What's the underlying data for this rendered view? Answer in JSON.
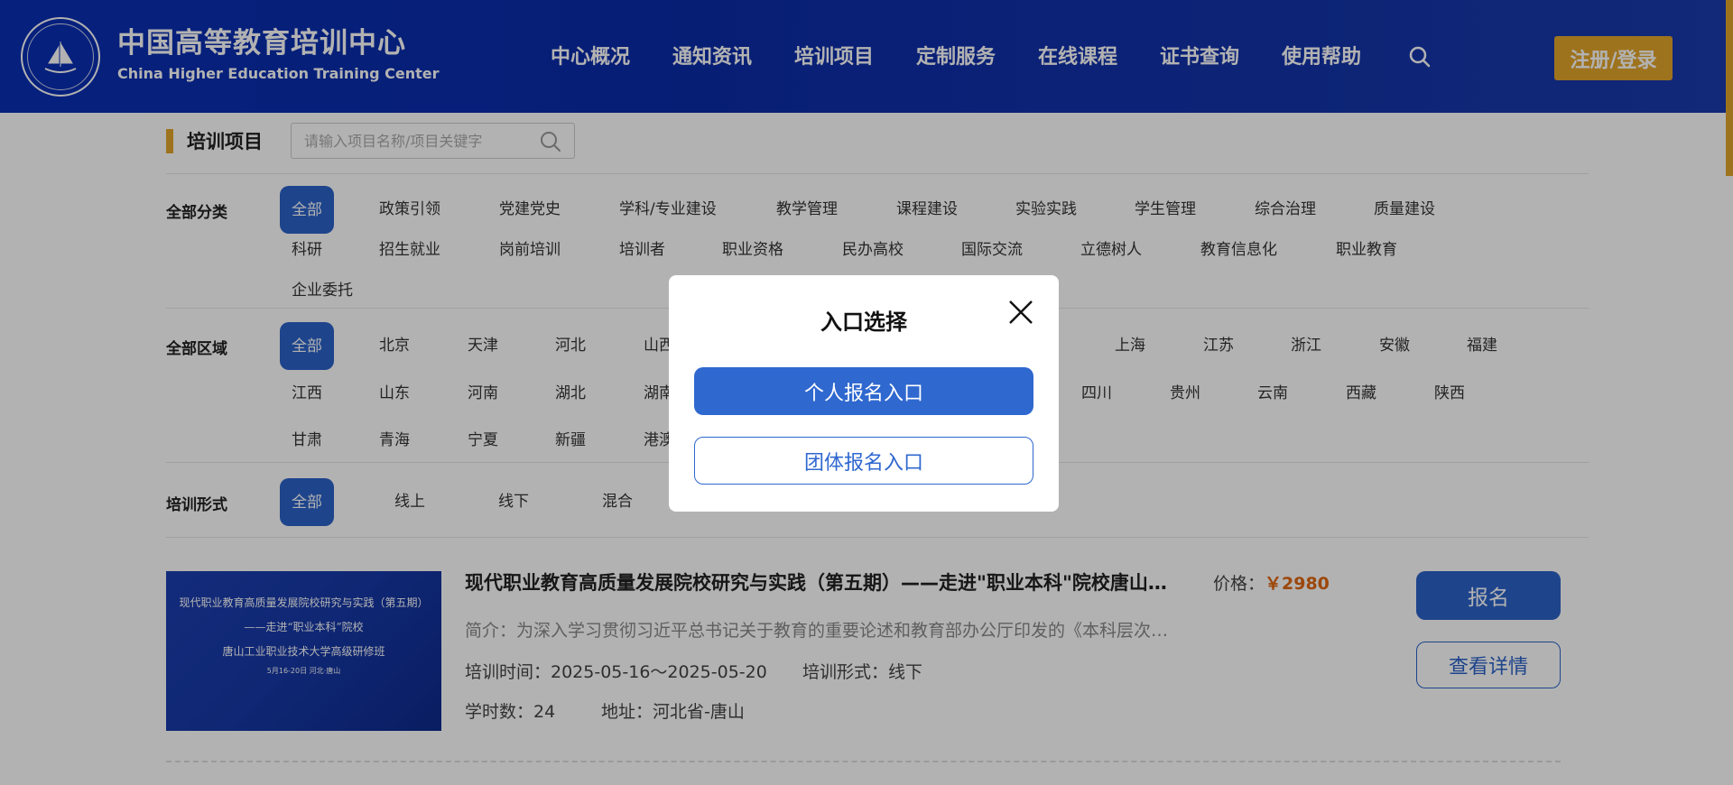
{
  "header": {
    "brand_cn": "中国高等教育培训中心",
    "brand_en": "China Higher Education Training Center",
    "nav": [
      "中心概况",
      "通知资讯",
      "培训项目",
      "定制服务",
      "在线课程",
      "证书查询",
      "使用帮助"
    ],
    "login_label": "注册/登录"
  },
  "page": {
    "title": "培训项目",
    "search_placeholder": "请输入项目名称/项目关键字"
  },
  "filters": {
    "category_label": "全部分类",
    "category_row1": [
      "全部",
      "政策引领",
      "党建党史",
      "学科/专业建设",
      "教学管理",
      "课程建设",
      "实验实践",
      "学生管理",
      "综合治理",
      "质量建设"
    ],
    "category_row2": [
      "科研",
      "招生就业",
      "岗前培训",
      "培训者",
      "职业资格",
      "民办高校",
      "国际交流",
      "立德树人",
      "教育信息化",
      "职业教育"
    ],
    "category_row3": [
      "企业委托"
    ],
    "region_label": "全部区域",
    "region_row1_left": [
      "全部",
      "北京",
      "天津",
      "河北",
      "山西"
    ],
    "region_row1_right": [
      "上海",
      "江苏",
      "浙江",
      "安徽",
      "福建"
    ],
    "region_row2_left": [
      "江西",
      "山东",
      "河南",
      "湖北",
      "湖南"
    ],
    "region_row2_right": [
      "四川",
      "贵州",
      "云南",
      "西藏",
      "陕西"
    ],
    "region_row3": [
      "甘肃",
      "青海",
      "宁夏",
      "新疆",
      "港澳"
    ],
    "format_label": "培训形式",
    "format_items": [
      "全部",
      "线上",
      "线下",
      "混合"
    ]
  },
  "course": {
    "image_lines": [
      "现代职业教育高质量发展院校研究与实践（第五期）",
      "——走进“职业本科”院校",
      "唐山工业职业技术大学高级研修班",
      "5月16-20日 河北·唐山"
    ],
    "title": "现代职业教育高质量发展院校研究与实践（第五期）——走进\"职业本科\"院校唐山工业职业技术大学高级研修班",
    "intro": "简介：为深入学习贯彻习近平总书记关于教育的重要论述和教育部办公厅印发的《本科层次职业学校设置标准》",
    "time": "培训时间：2025-05-16～2025-05-20",
    "format": "培训形式：线下",
    "hours": "学时数：24",
    "address": "地址：河北省-唐山",
    "price_label": "价格：",
    "price_value": "￥2980",
    "apply_label": "报名",
    "detail_label": "查看详情"
  },
  "modal": {
    "title": "入口选择",
    "personal_label": "个人报名入口",
    "group_label": "团体报名入口"
  },
  "colors": {
    "header_blue": "#0a2fb4",
    "accent_orange": "#e3a52b",
    "primary_blue": "#2b62c9",
    "price_orange": "#e0660f"
  }
}
